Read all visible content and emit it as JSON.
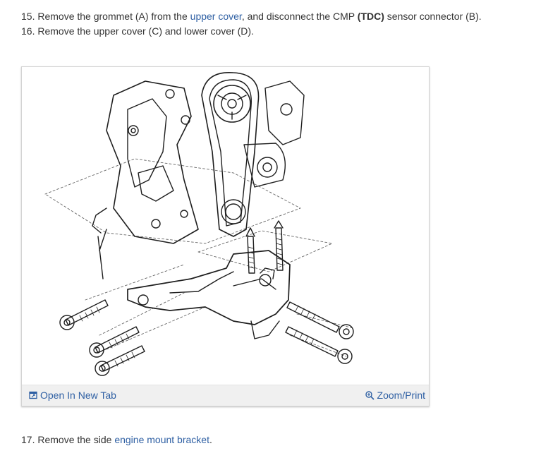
{
  "steps": [
    {
      "number": "15.",
      "prefix": "Remove the grommet (A) from the ",
      "link": "upper cover",
      "middle": ", and disconnect the CMP ",
      "bold": "(TDC)",
      "suffix": " sensor connector (B)."
    },
    {
      "number": "16.",
      "text": "Remove the upper cover (C) and lower cover (D)."
    },
    {
      "number": "17.",
      "prefix": "Remove the side ",
      "link": "engine mount bracket",
      "suffix": "."
    }
  ],
  "figure": {
    "open_tab_label": "Open In New Tab",
    "zoom_label": "Zoom/Print",
    "open_tab_icon": "new-tab-icon",
    "zoom_icon": "magnifier-icon",
    "link_color": "#2e5fa3"
  }
}
